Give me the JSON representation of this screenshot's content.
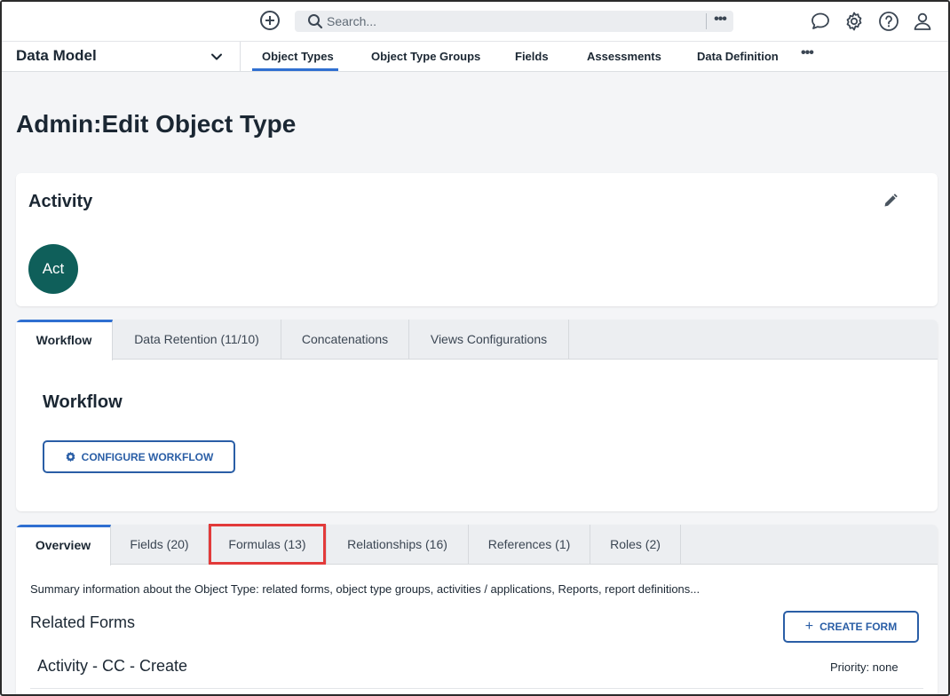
{
  "topbar": {
    "search_placeholder": "Search...",
    "search_more": "•••",
    "icons": [
      "add-circle-icon",
      "search-icon",
      "chat-icon",
      "gear-icon",
      "help-icon",
      "user-icon"
    ]
  },
  "nav": {
    "title": "Data Model",
    "tabs": [
      {
        "label": "Object Types",
        "active": true
      },
      {
        "label": "Object Type Groups"
      },
      {
        "label": "Fields"
      },
      {
        "label": "Assessments"
      },
      {
        "label": "Data Definition"
      }
    ],
    "more": "•••",
    "accent": "#2f6fd1"
  },
  "page": {
    "title_prefix": "Admin",
    "title_sep": ":",
    "title_main": "Edit Object Type"
  },
  "activity": {
    "title": "Activity",
    "avatar_text": "Act",
    "avatar_color": "#0f5f5a"
  },
  "workflow_tabs": [
    {
      "label": "Workflow",
      "active": true
    },
    {
      "label": "Data Retention (11/10)"
    },
    {
      "label": "Concatenations"
    },
    {
      "label": "Views Configurations"
    }
  ],
  "workflow": {
    "heading": "Workflow",
    "configure_label": "CONFIGURE WORKFLOW"
  },
  "overview_tabs": [
    {
      "label": "Overview",
      "active": true
    },
    {
      "label": "Fields (20)"
    },
    {
      "label": "Formulas (13)",
      "highlighted": true
    },
    {
      "label": "Relationships (16)"
    },
    {
      "label": "References (1)"
    },
    {
      "label": "Roles (2)"
    }
  ],
  "overview": {
    "summary": "Summary information about the Object Type: related forms, object type groups, activities / applications, Reports, report definitions...",
    "related_forms_heading": "Related Forms",
    "create_form_label": "CREATE FORM",
    "create_form_icon": "+",
    "forms": [
      {
        "name": "Activity - CC - Create",
        "priority": "Priority: none"
      }
    ]
  },
  "colors": {
    "button_blue": "#2a5ea6",
    "highlight_red": "#e23a3a"
  }
}
